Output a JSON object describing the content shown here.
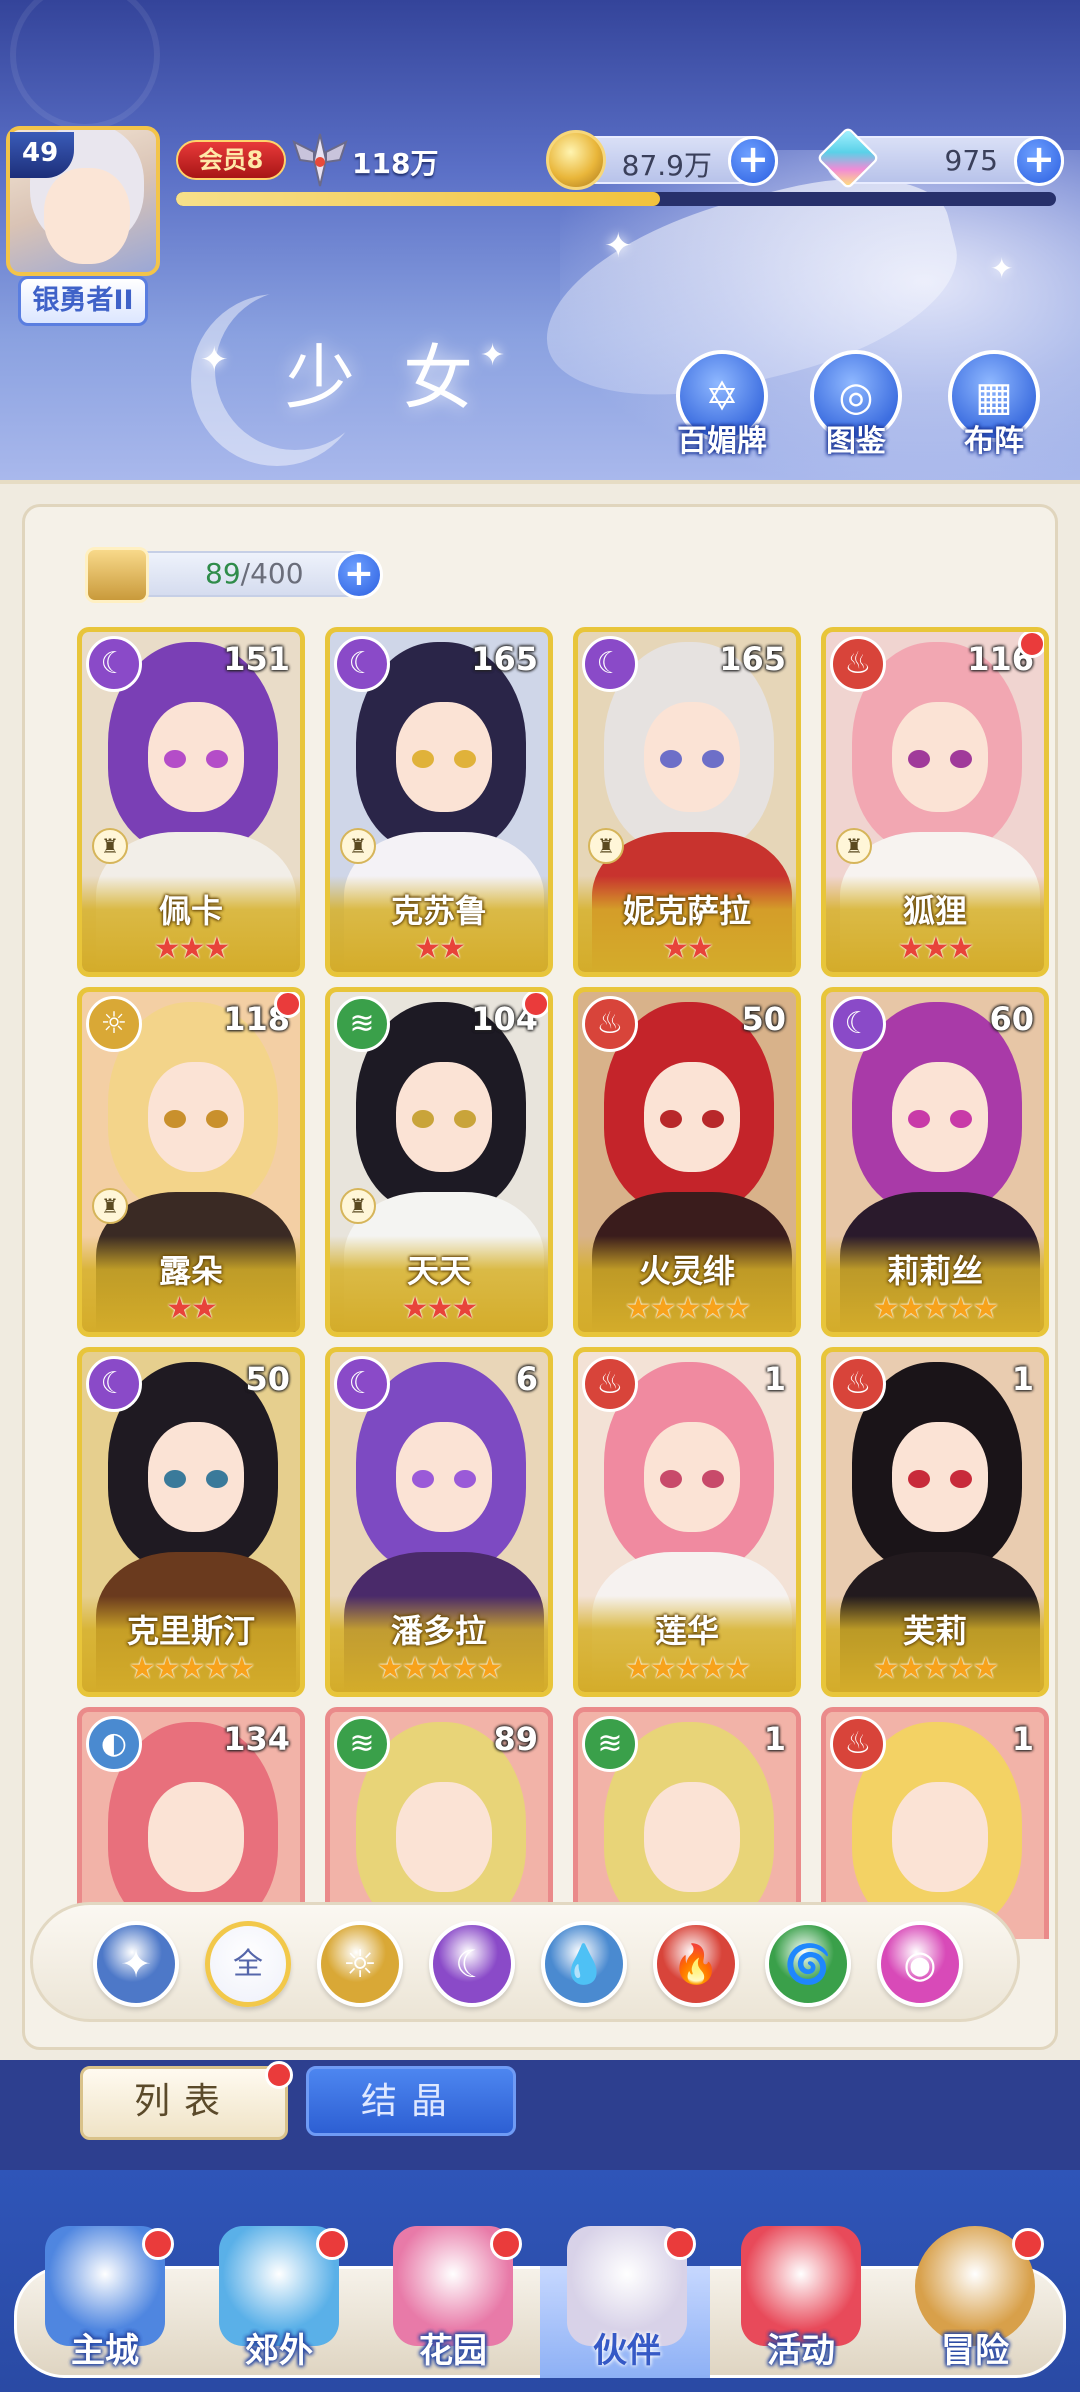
{
  "player": {
    "level": "49",
    "rank": "银勇者II",
    "vip": "会员8",
    "power": "118万",
    "gold": "87.9万",
    "gems": "975",
    "exp_progress": 0.55
  },
  "header": {
    "title": "少女",
    "buttons": [
      {
        "label": "百媚牌",
        "icon": "card-deck-icon"
      },
      {
        "label": "图鉴",
        "icon": "book-icon"
      },
      {
        "label": "布阵",
        "icon": "grid-formation-icon"
      }
    ]
  },
  "capacity": {
    "current": "89",
    "sep": "/400"
  },
  "cards": [
    {
      "name": "佩卡",
      "level": "151",
      "element": "moon",
      "stars": 3,
      "star_color": "red",
      "rook": true,
      "dot": false,
      "hair": "#7a3fb5",
      "skin_bg": "#e9dcc8",
      "body": "#f2eee8",
      "eye": "#b44dc8"
    },
    {
      "name": "克苏鲁",
      "level": "165",
      "element": "moon",
      "stars": 2,
      "star_color": "red",
      "rook": true,
      "dot": false,
      "hair": "#2a2548",
      "skin_bg": "#cfd6e8",
      "body": "#f4f2f6",
      "eye": "#e0b23a"
    },
    {
      "name": "妮克萨拉",
      "level": "165",
      "element": "moon",
      "stars": 2,
      "star_color": "red",
      "rook": true,
      "dot": false,
      "hair": "#e6e2e0",
      "skin_bg": "#e6d6b8",
      "body": "#c8332e",
      "eye": "#6d6fc8"
    },
    {
      "name": "狐狸",
      "level": "116",
      "element": "fire",
      "stars": 3,
      "star_color": "red",
      "rook": true,
      "dot": true,
      "hair": "#f2a7b2",
      "skin_bg": "#f0d4d0",
      "body": "#f7f3f0",
      "eye": "#a03a9a"
    },
    {
      "name": "露朵",
      "level": "118",
      "element": "sun",
      "stars": 2,
      "star_color": "red",
      "rook": true,
      "dot": true,
      "hair": "#f3d48a",
      "skin_bg": "#f3cfa4",
      "body": "#3a2a24",
      "eye": "#c9902c"
    },
    {
      "name": "天天",
      "level": "104",
      "element": "wind",
      "stars": 3,
      "star_color": "red",
      "rook": true,
      "dot": true,
      "hair": "#1d1a24",
      "skin_bg": "#e8e4dc",
      "body": "#f4f4f2",
      "eye": "#c9a43a"
    },
    {
      "name": "火灵绯",
      "level": "50",
      "element": "fire",
      "stars": 5,
      "star_color": "gold",
      "rook": false,
      "dot": false,
      "hair": "#c4242a",
      "skin_bg": "#d8b28a",
      "body": "#3a1c1c",
      "eye": "#b8282a"
    },
    {
      "name": "莉莉丝",
      "level": "60",
      "element": "moon",
      "stars": 5,
      "star_color": "gold",
      "rook": false,
      "dot": false,
      "hair": "#a93aa8",
      "skin_bg": "#e7c6a6",
      "body": "#2a1a2c",
      "eye": "#c83aa8"
    },
    {
      "name": "克里斯汀",
      "level": "50",
      "element": "moon",
      "stars": 5,
      "star_color": "gold",
      "rook": false,
      "dot": false,
      "hair": "#1f1a22",
      "skin_bg": "#e6cf8e",
      "body": "#6a3a1e",
      "eye": "#3a7a9a"
    },
    {
      "name": "潘多拉",
      "level": "6",
      "element": "moon",
      "stars": 5,
      "star_color": "gold",
      "rook": false,
      "dot": false,
      "hair": "#7d4ac2",
      "skin_bg": "#e9d6b8",
      "body": "#4a2a6a",
      "eye": "#9a5ad8"
    },
    {
      "name": "莲华",
      "level": "1",
      "element": "fire",
      "stars": 5,
      "star_color": "gold",
      "rook": false,
      "dot": false,
      "hair": "#f08aa0",
      "skin_bg": "#f3e2d6",
      "body": "#f6f2f0",
      "eye": "#c84a6a"
    },
    {
      "name": "芙莉",
      "level": "1",
      "element": "fire",
      "stars": 5,
      "star_color": "gold",
      "rook": false,
      "dot": false,
      "hair": "#1a1418",
      "skin_bg": "#e9ccb0",
      "body": "#221a1e",
      "eye": "#c82a3a"
    }
  ],
  "partial_cards": [
    {
      "level": "134",
      "element": "water",
      "hair": "#e8707c",
      "skin_bg": "#f2b3a8"
    },
    {
      "level": "89",
      "element": "wind",
      "hair": "#e8d478",
      "skin_bg": "#f2b3a8"
    },
    {
      "level": "1",
      "element": "wind",
      "hair": "#e8d478",
      "skin_bg": "#f2b3a8"
    },
    {
      "level": "1",
      "element": "fire",
      "hair": "#f3d264",
      "skin_bg": "#f2b3a8"
    }
  ],
  "filters": [
    {
      "name": "filter-star",
      "glyph": "✦",
      "color": "#4d78c8"
    },
    {
      "name": "filter-all",
      "glyph": "全",
      "color": "#ffffff"
    },
    {
      "name": "filter-sun",
      "glyph": "☼",
      "color": "#d9a836"
    },
    {
      "name": "filter-moon",
      "glyph": "☾",
      "color": "#8a4ac8"
    },
    {
      "name": "filter-water",
      "glyph": "💧",
      "color": "#4a8ad0"
    },
    {
      "name": "filter-fire",
      "glyph": "🔥",
      "color": "#d8443a"
    },
    {
      "name": "filter-wind",
      "glyph": "🌀",
      "color": "#3aa04a"
    },
    {
      "name": "filter-light",
      "glyph": "◉",
      "color": "#d84ab8"
    }
  ],
  "subtabs": {
    "list": "列表",
    "crystal": "结晶"
  },
  "nav": [
    {
      "label": "主城",
      "icon": "castle-icon",
      "dot": true,
      "color": "#4f86e0"
    },
    {
      "label": "郊外",
      "icon": "portal-icon",
      "dot": true,
      "color": "#5ab0e8"
    },
    {
      "label": "花园",
      "icon": "heart-garden-icon",
      "dot": true,
      "color": "#e87aa8"
    },
    {
      "label": "伙伴",
      "icon": "partner-icon",
      "dot": true,
      "color": "#d8d2e8"
    },
    {
      "label": "活动",
      "icon": "gift-icon",
      "dot": false,
      "color": "#e84a5a"
    },
    {
      "label": "冒险",
      "icon": "compass-icon",
      "dot": true,
      "color": "#d8a04a"
    }
  ]
}
